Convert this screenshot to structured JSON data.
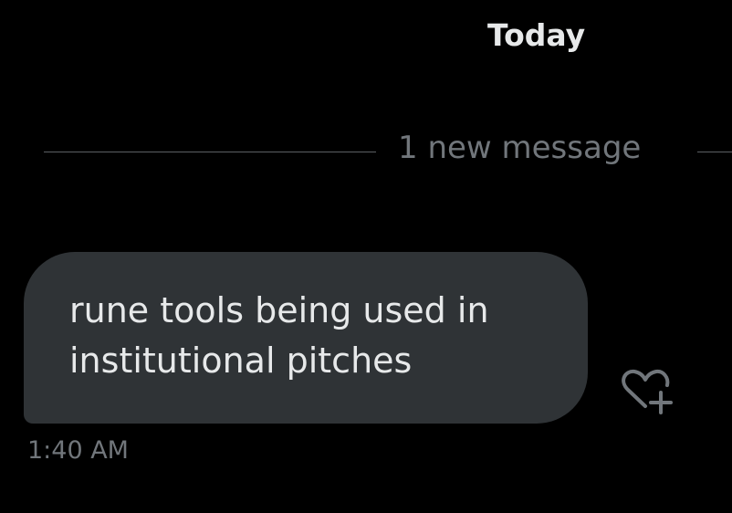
{
  "conversation": {
    "date_header": "Today",
    "new_message_divider": "1 new message",
    "messages": [
      {
        "text": "rune tools being used in\ninstitutional pitches",
        "timestamp": "1:40 AM",
        "reaction_icon": "heart-plus-icon"
      }
    ]
  },
  "colors": {
    "background": "#000000",
    "bubble": "#2f3336",
    "primary_text": "#e7e9ea",
    "secondary_text": "#71767b",
    "divider": "#5b5f63"
  }
}
